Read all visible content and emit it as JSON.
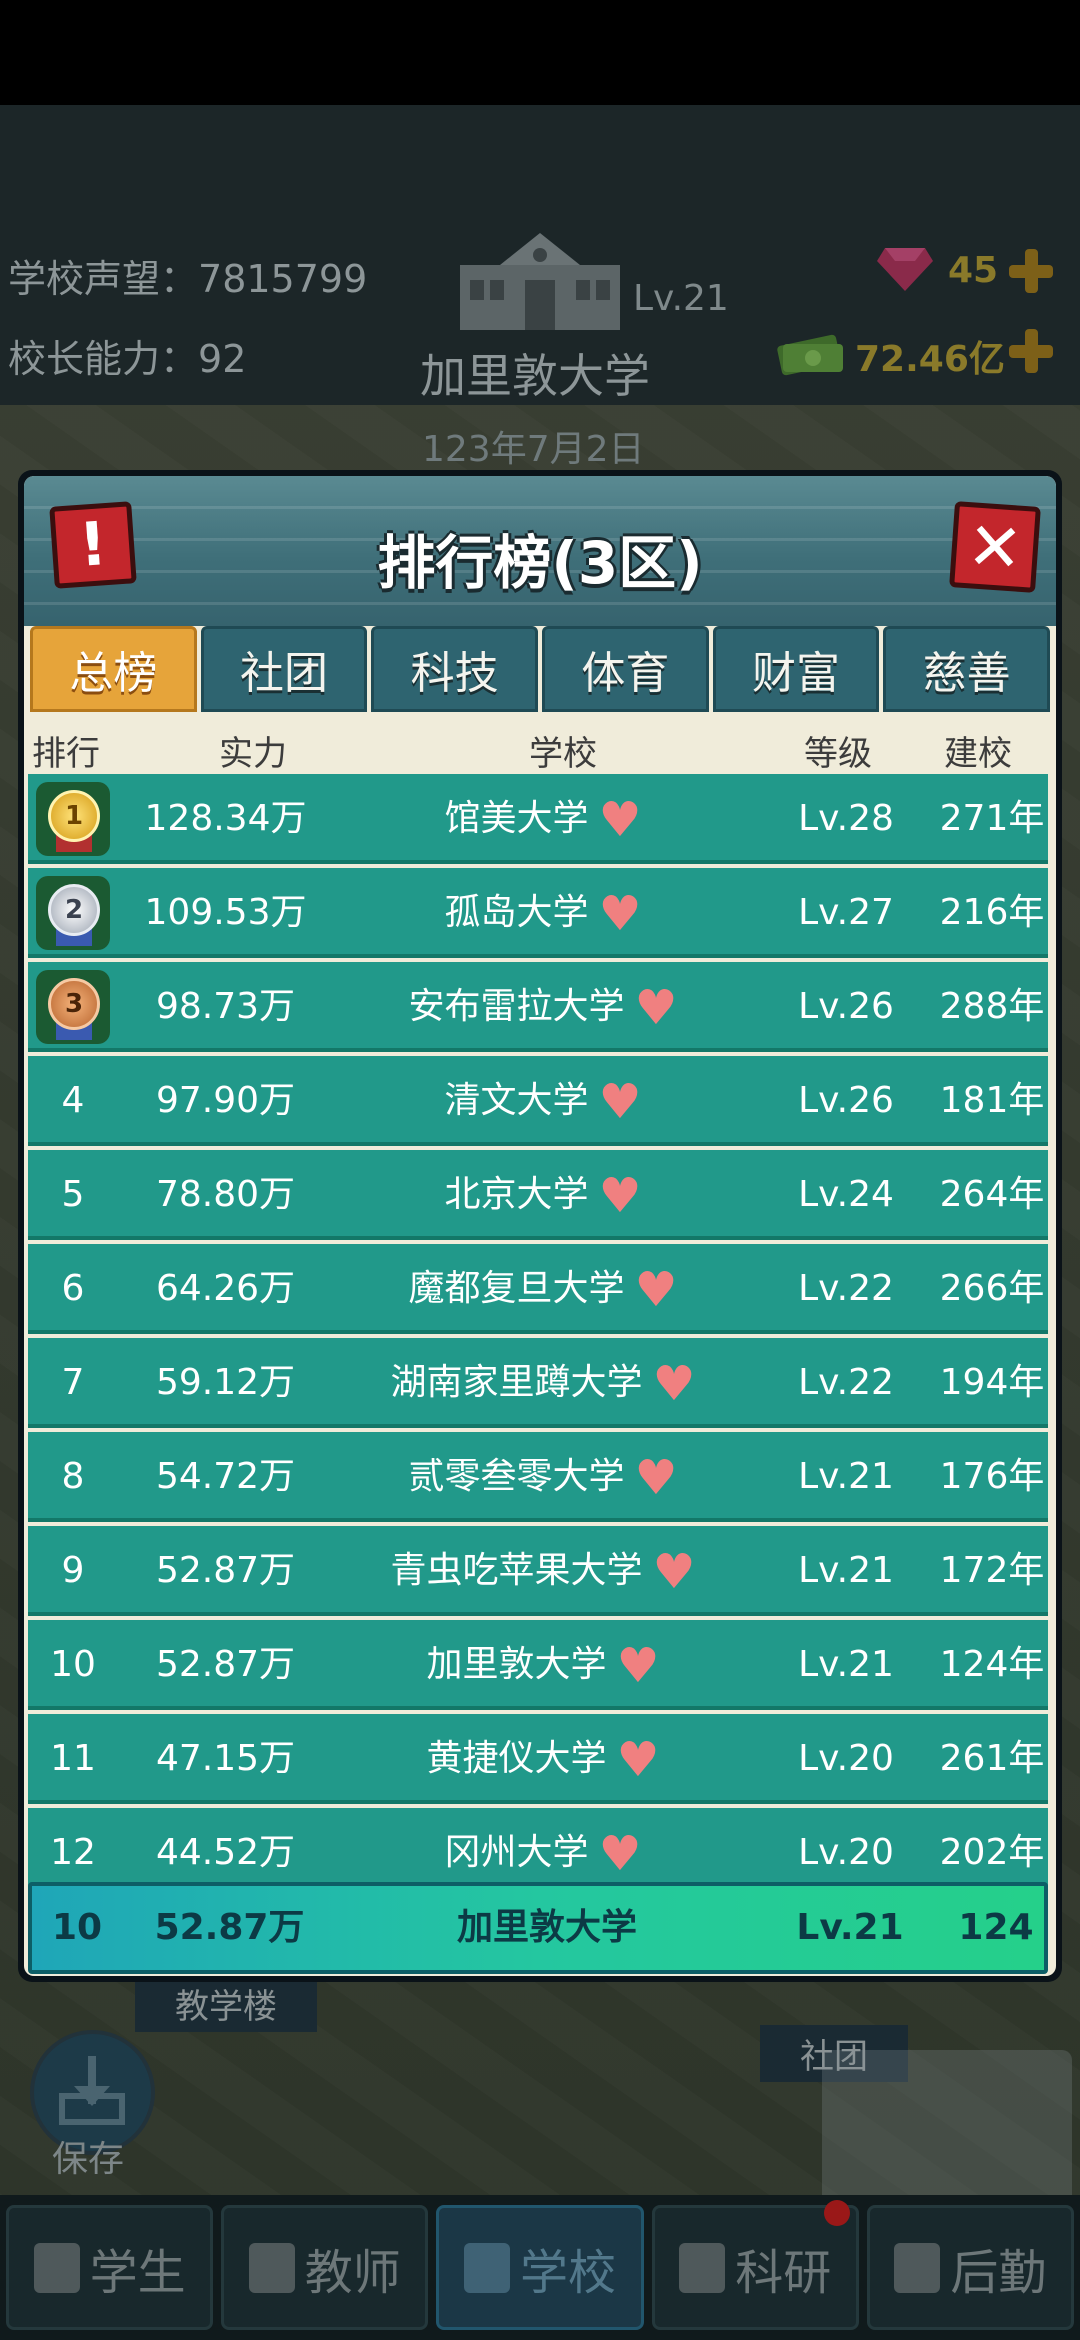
{
  "hud": {
    "reputation_label": "学校声望",
    "reputation_value": "7815799",
    "ability_label": "校长能力",
    "ability_value": "92",
    "level": "Lv.21",
    "school_name": "加里敦大学",
    "date": "123年7月2日",
    "gems": "45",
    "cash": "72.46亿"
  },
  "map": {
    "save_label": "保存",
    "teaching_building": "教学楼",
    "club_label": "社团"
  },
  "panel": {
    "title": "排行榜(3区)",
    "info_glyph": "!",
    "close_glyph": "✕",
    "tabs": [
      "总榜",
      "社团",
      "科技",
      "体育",
      "财富",
      "慈善"
    ],
    "active_tab": 0,
    "columns": {
      "rank": "排行",
      "power": "实力",
      "school": "学校",
      "level": "等级",
      "founded": "建校"
    },
    "rows": [
      {
        "rank": "1",
        "power": "128.34万",
        "school": "馆美大学",
        "level": "Lv.28",
        "founded": "271年"
      },
      {
        "rank": "2",
        "power": "109.53万",
        "school": "孤岛大学",
        "level": "Lv.27",
        "founded": "216年"
      },
      {
        "rank": "3",
        "power": "98.73万",
        "school": "安布雷拉大学",
        "level": "Lv.26",
        "founded": "288年"
      },
      {
        "rank": "4",
        "power": "97.90万",
        "school": "清文大学",
        "level": "Lv.26",
        "founded": "181年"
      },
      {
        "rank": "5",
        "power": "78.80万",
        "school": "北京大学",
        "level": "Lv.24",
        "founded": "264年"
      },
      {
        "rank": "6",
        "power": "64.26万",
        "school": "魔都复旦大学",
        "level": "Lv.22",
        "founded": "266年"
      },
      {
        "rank": "7",
        "power": "59.12万",
        "school": "湖南家里蹲大学",
        "level": "Lv.22",
        "founded": "194年"
      },
      {
        "rank": "8",
        "power": "54.72万",
        "school": "贰零叁零大学",
        "level": "Lv.21",
        "founded": "176年"
      },
      {
        "rank": "9",
        "power": "52.87万",
        "school": "青虫吃苹果大学",
        "level": "Lv.21",
        "founded": "172年"
      },
      {
        "rank": "10",
        "power": "52.87万",
        "school": "加里敦大学",
        "level": "Lv.21",
        "founded": "124年"
      },
      {
        "rank": "11",
        "power": "47.15万",
        "school": "黄捷仪大学",
        "level": "Lv.20",
        "founded": "261年"
      },
      {
        "rank": "12",
        "power": "44.52万",
        "school": "冈州大学",
        "level": "Lv.20",
        "founded": "202年"
      }
    ],
    "my_row": {
      "rank": "10",
      "power": "52.87万",
      "school": "加里敦大学",
      "level": "Lv.21",
      "founded": "124"
    }
  },
  "bottom_nav": {
    "tabs": [
      "学生",
      "教师",
      "学校",
      "科研",
      "后勤"
    ],
    "active": 2
  },
  "colors": {
    "row_teal": "#21998a",
    "tab_active": "#e6a43a",
    "close_red": "#c3262c",
    "heart": "#f08080"
  }
}
